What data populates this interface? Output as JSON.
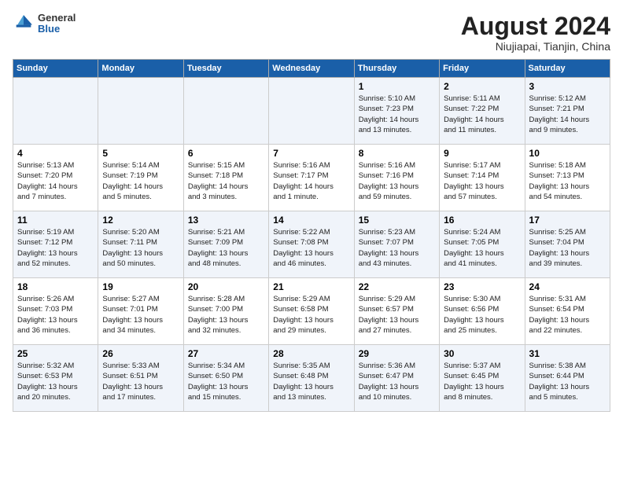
{
  "header": {
    "logo_line1": "General",
    "logo_line2": "Blue",
    "month_year": "August 2024",
    "location": "Niujiapai, Tianjin, China"
  },
  "weekdays": [
    "Sunday",
    "Monday",
    "Tuesday",
    "Wednesday",
    "Thursday",
    "Friday",
    "Saturday"
  ],
  "weeks": [
    [
      {
        "day": "",
        "info": ""
      },
      {
        "day": "",
        "info": ""
      },
      {
        "day": "",
        "info": ""
      },
      {
        "day": "",
        "info": ""
      },
      {
        "day": "1",
        "info": "Sunrise: 5:10 AM\nSunset: 7:23 PM\nDaylight: 14 hours\nand 13 minutes."
      },
      {
        "day": "2",
        "info": "Sunrise: 5:11 AM\nSunset: 7:22 PM\nDaylight: 14 hours\nand 11 minutes."
      },
      {
        "day": "3",
        "info": "Sunrise: 5:12 AM\nSunset: 7:21 PM\nDaylight: 14 hours\nand 9 minutes."
      }
    ],
    [
      {
        "day": "4",
        "info": "Sunrise: 5:13 AM\nSunset: 7:20 PM\nDaylight: 14 hours\nand 7 minutes."
      },
      {
        "day": "5",
        "info": "Sunrise: 5:14 AM\nSunset: 7:19 PM\nDaylight: 14 hours\nand 5 minutes."
      },
      {
        "day": "6",
        "info": "Sunrise: 5:15 AM\nSunset: 7:18 PM\nDaylight: 14 hours\nand 3 minutes."
      },
      {
        "day": "7",
        "info": "Sunrise: 5:16 AM\nSunset: 7:17 PM\nDaylight: 14 hours\nand 1 minute."
      },
      {
        "day": "8",
        "info": "Sunrise: 5:16 AM\nSunset: 7:16 PM\nDaylight: 13 hours\nand 59 minutes."
      },
      {
        "day": "9",
        "info": "Sunrise: 5:17 AM\nSunset: 7:14 PM\nDaylight: 13 hours\nand 57 minutes."
      },
      {
        "day": "10",
        "info": "Sunrise: 5:18 AM\nSunset: 7:13 PM\nDaylight: 13 hours\nand 54 minutes."
      }
    ],
    [
      {
        "day": "11",
        "info": "Sunrise: 5:19 AM\nSunset: 7:12 PM\nDaylight: 13 hours\nand 52 minutes."
      },
      {
        "day": "12",
        "info": "Sunrise: 5:20 AM\nSunset: 7:11 PM\nDaylight: 13 hours\nand 50 minutes."
      },
      {
        "day": "13",
        "info": "Sunrise: 5:21 AM\nSunset: 7:09 PM\nDaylight: 13 hours\nand 48 minutes."
      },
      {
        "day": "14",
        "info": "Sunrise: 5:22 AM\nSunset: 7:08 PM\nDaylight: 13 hours\nand 46 minutes."
      },
      {
        "day": "15",
        "info": "Sunrise: 5:23 AM\nSunset: 7:07 PM\nDaylight: 13 hours\nand 43 minutes."
      },
      {
        "day": "16",
        "info": "Sunrise: 5:24 AM\nSunset: 7:05 PM\nDaylight: 13 hours\nand 41 minutes."
      },
      {
        "day": "17",
        "info": "Sunrise: 5:25 AM\nSunset: 7:04 PM\nDaylight: 13 hours\nand 39 minutes."
      }
    ],
    [
      {
        "day": "18",
        "info": "Sunrise: 5:26 AM\nSunset: 7:03 PM\nDaylight: 13 hours\nand 36 minutes."
      },
      {
        "day": "19",
        "info": "Sunrise: 5:27 AM\nSunset: 7:01 PM\nDaylight: 13 hours\nand 34 minutes."
      },
      {
        "day": "20",
        "info": "Sunrise: 5:28 AM\nSunset: 7:00 PM\nDaylight: 13 hours\nand 32 minutes."
      },
      {
        "day": "21",
        "info": "Sunrise: 5:29 AM\nSunset: 6:58 PM\nDaylight: 13 hours\nand 29 minutes."
      },
      {
        "day": "22",
        "info": "Sunrise: 5:29 AM\nSunset: 6:57 PM\nDaylight: 13 hours\nand 27 minutes."
      },
      {
        "day": "23",
        "info": "Sunrise: 5:30 AM\nSunset: 6:56 PM\nDaylight: 13 hours\nand 25 minutes."
      },
      {
        "day": "24",
        "info": "Sunrise: 5:31 AM\nSunset: 6:54 PM\nDaylight: 13 hours\nand 22 minutes."
      }
    ],
    [
      {
        "day": "25",
        "info": "Sunrise: 5:32 AM\nSunset: 6:53 PM\nDaylight: 13 hours\nand 20 minutes."
      },
      {
        "day": "26",
        "info": "Sunrise: 5:33 AM\nSunset: 6:51 PM\nDaylight: 13 hours\nand 17 minutes."
      },
      {
        "day": "27",
        "info": "Sunrise: 5:34 AM\nSunset: 6:50 PM\nDaylight: 13 hours\nand 15 minutes."
      },
      {
        "day": "28",
        "info": "Sunrise: 5:35 AM\nSunset: 6:48 PM\nDaylight: 13 hours\nand 13 minutes."
      },
      {
        "day": "29",
        "info": "Sunrise: 5:36 AM\nSunset: 6:47 PM\nDaylight: 13 hours\nand 10 minutes."
      },
      {
        "day": "30",
        "info": "Sunrise: 5:37 AM\nSunset: 6:45 PM\nDaylight: 13 hours\nand 8 minutes."
      },
      {
        "day": "31",
        "info": "Sunrise: 5:38 AM\nSunset: 6:44 PM\nDaylight: 13 hours\nand 5 minutes."
      }
    ]
  ]
}
